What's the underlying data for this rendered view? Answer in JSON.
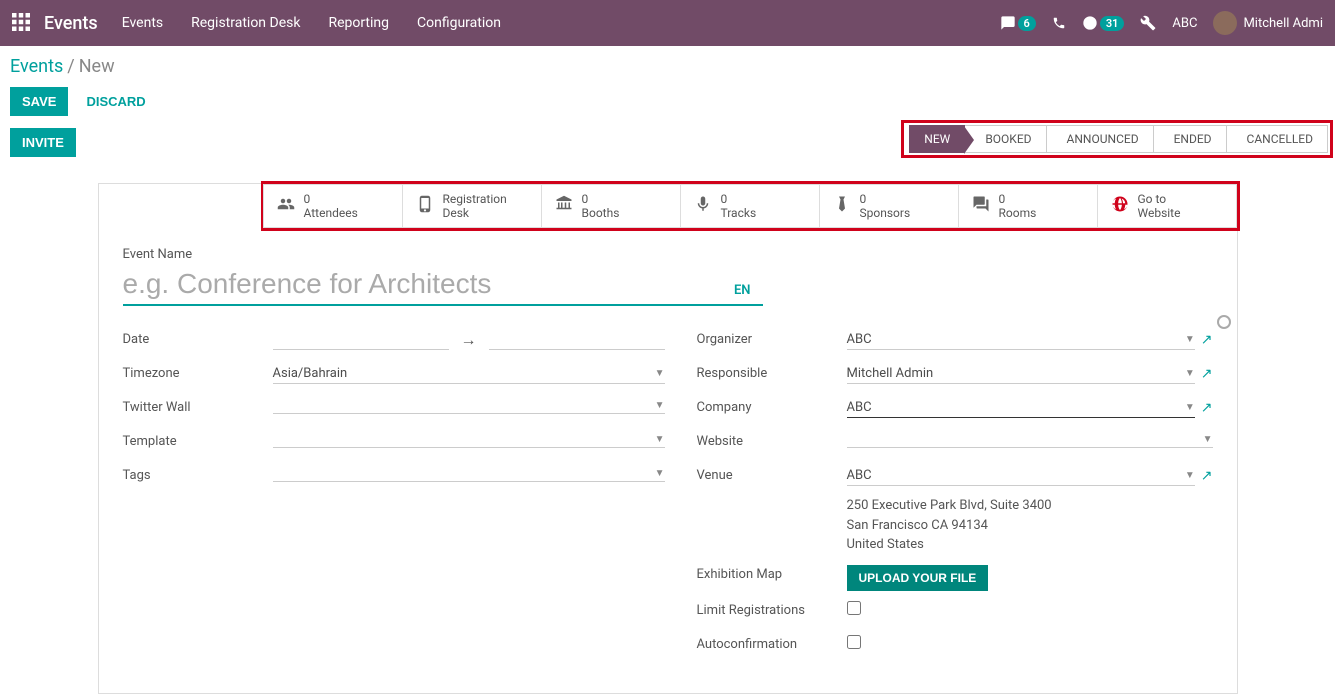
{
  "topbar": {
    "app_title": "Events",
    "menu": [
      "Events",
      "Registration Desk",
      "Reporting",
      "Configuration"
    ],
    "chat_count": "6",
    "activity_count": "31",
    "company": "ABC",
    "user": "Mitchell Admi"
  },
  "breadcrumb": {
    "root": "Events",
    "current": "New"
  },
  "actions": {
    "save": "SAVE",
    "discard": "DISCARD",
    "invite": "INVITE"
  },
  "status": [
    "NEW",
    "BOOKED",
    "ANNOUNCED",
    "ENDED",
    "CANCELLED"
  ],
  "stat_buttons": [
    {
      "count": "0",
      "label": "Attendees"
    },
    {
      "count": "",
      "label": "Registration",
      "label2": "Desk"
    },
    {
      "count": "0",
      "label": "Booths"
    },
    {
      "count": "0",
      "label": "Tracks"
    },
    {
      "count": "0",
      "label": "Sponsors"
    },
    {
      "count": "0",
      "label": "Rooms"
    },
    {
      "count": "",
      "label": "Go to",
      "label2": "Website"
    }
  ],
  "form": {
    "event_name_label": "Event Name",
    "event_name_placeholder": "e.g. Conference for Architects",
    "lang": "EN",
    "left": {
      "date": "Date",
      "timezone": "Timezone",
      "timezone_value": "Asia/Bahrain",
      "twitter": "Twitter Wall",
      "template": "Template",
      "tags": "Tags"
    },
    "right": {
      "organizer": "Organizer",
      "organizer_value": "ABC",
      "responsible": "Responsible",
      "responsible_value": "Mitchell Admin",
      "company": "Company",
      "company_value": "ABC",
      "website": "Website",
      "venue": "Venue",
      "venue_value": "ABC",
      "addr1": "250 Executive Park Blvd, Suite 3400",
      "addr2": "San Francisco CA 94134",
      "addr3": "United States",
      "exhibition": "Exhibition Map",
      "upload": "UPLOAD YOUR FILE",
      "limit": "Limit Registrations",
      "autoconfirm": "Autoconfirmation"
    }
  }
}
